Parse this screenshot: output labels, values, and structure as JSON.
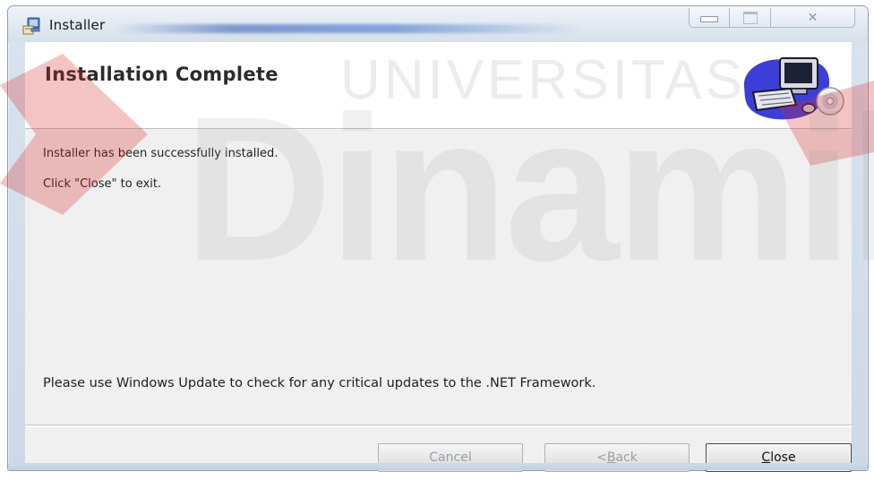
{
  "window": {
    "title": "Installer",
    "controls": {
      "minimize": "minimize",
      "maximize": "maximize",
      "close": "close"
    }
  },
  "header": {
    "title": "Installation Complete",
    "graphic_icon": "computer-with-disc-icon"
  },
  "body": {
    "line1": "Installer has been successfully installed.",
    "line2": "Click \"Close\" to exit.",
    "line3": "Please use Windows Update to check for any critical updates to the .NET Framework."
  },
  "buttons": {
    "cancel": {
      "label": "Cancel",
      "enabled": false
    },
    "back": {
      "prefix": "< ",
      "mnemonic": "B",
      "rest": "ack",
      "enabled": false
    },
    "close": {
      "mnemonic": "C",
      "rest": "lose",
      "enabled": true
    }
  },
  "watermark": {
    "line1": "UNIVERSITAS",
    "line2": "Dinamika",
    "red_color": "#d82a2a",
    "gray_color": "#8a8a8a"
  },
  "colors": {
    "title_glow": "#4a6fbe",
    "header_bg": "#ffffff",
    "body_bg": "#f0f0f0"
  }
}
